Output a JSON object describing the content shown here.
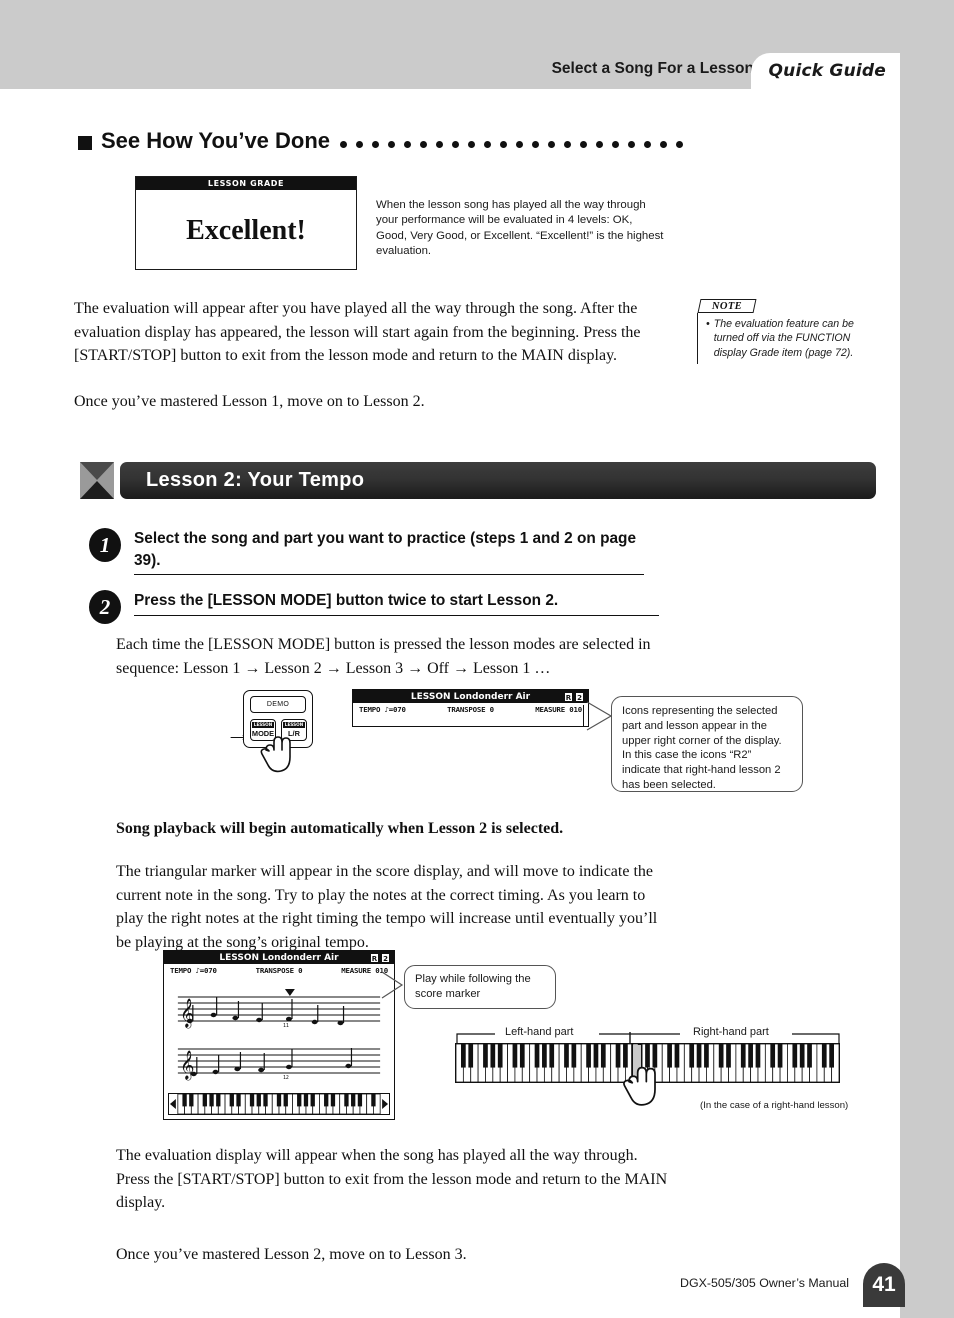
{
  "header": {
    "section_title": "Select a Song For a Lesson",
    "tab_label": "Quick Guide"
  },
  "see_how": {
    "heading": "See How You’ve Done",
    "dot_count": 22,
    "grade_display": {
      "bar_label": "LESSON GRADE",
      "grade_word": "Excellent!"
    },
    "caption": "When the lesson song has played all the way through your performance will be evaluated in 4 levels: OK, Good, Very Good, or Excellent. “Excellent!” is the highest evaluation."
  },
  "paragraphs": {
    "p1": "The evaluation will appear after you have played all the way through the song. After the evaluation display has appeared, the lesson will start again from the beginning. Press the [START/STOP] button to exit from the lesson mode and return to the MAIN display.",
    "p2": "Once you’ve mastered Lesson 1, move on to Lesson 2.",
    "p3": "Each time the [LESSON MODE] button is pressed the lesson modes are selected in sequence: Lesson 1 → Lesson 2 → Lesson 3 → Off → Lesson 1 …",
    "bold_note": "Song playback will begin automatically when Lesson 2 is selected.",
    "p_triangular": "The triangular marker will appear in the score display, and will move to indicate the current note in the song. Try to play the notes at the correct timing. As you learn to play the right notes at the right timing the tempo will increase until eventually you’ll be playing at the song’s original tempo.",
    "p4": "The evaluation display will appear when the song has played all the way through.\nPress the [START/STOP] button to exit from the lesson mode and return to the MAIN display.",
    "p5": "Once you’ve mastered Lesson 2, move on to Lesson 3."
  },
  "note_box": {
    "label": "NOTE",
    "bullet": "•",
    "text": "The evaluation feature can be turned off via the FUNCTION display Grade item (page 72)."
  },
  "lesson_banner": {
    "title": "Lesson 2: Your Tempo"
  },
  "steps": [
    {
      "number": "1",
      "text": "Select the song and part you want to practice (steps 1 and 2 on page 39)."
    },
    {
      "number": "2",
      "text": "Press the [LESSON MODE] button twice to start Lesson 2."
    }
  ],
  "panel": {
    "demo_button": "DEMO",
    "lesson_tag": "LESSON",
    "mode_button": "MODE",
    "lr_button": "L/R"
  },
  "lcd_small": {
    "title_prefix": "LESSON",
    "song_name": "Londonderr Air",
    "badges": [
      "R",
      "2"
    ],
    "tempo": "TEMPO ♪=070",
    "transpose": "TRANSPOSE    0",
    "measure": "MEASURE 010"
  },
  "lcd_big": {
    "title_prefix": "LESSON",
    "song_name": "Londonderr Air",
    "badges": [
      "R",
      "2"
    ],
    "tempo": "TEMPO ♪=070",
    "transpose": "TRANSPOSE    0",
    "measure": "MEASURE 010",
    "measure_marks": [
      "11",
      "12"
    ]
  },
  "callouts": {
    "icons_callout": "Icons representing the selected part and lesson appear in the upper right corner of the display. In this case the icons “R2” indicate that right-hand lesson 2 has been selected.",
    "score_marker_callout": "Play while following the score marker"
  },
  "keyboard": {
    "left_label": "Left-hand part",
    "right_label": "Right-hand part",
    "case_note": "(In the case of a right-hand lesson)"
  },
  "footer": {
    "manual": "DGX-505/305  Owner’s Manual",
    "page": "41"
  },
  "colors": {
    "header_gray": "#cbcbcb",
    "banner_dark": "#2b2b2b",
    "ink": "#111111",
    "page_badge": "#3a3a3a"
  }
}
